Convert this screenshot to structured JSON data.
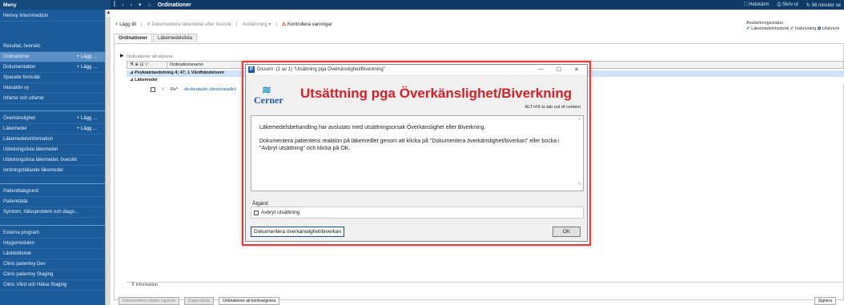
{
  "sidebar": {
    "title": "Meny",
    "header_item": "Hemvy Internmedicin",
    "items": [
      {
        "label": "Resultat, översikt",
        "add": ""
      },
      {
        "label": "Ordinationer",
        "add": "+ Lägg ..."
      },
      {
        "label": "Dokumentation",
        "add": "+ Lägg ..."
      },
      {
        "label": "Sparade formulär",
        "add": ""
      },
      {
        "label": "Interaktiv vy",
        "add": ""
      },
      {
        "label": "Infarter och utfarter",
        "add": ""
      },
      {
        "label": "Överkänslighet",
        "add": "+ Lägg ..."
      },
      {
        "label": "Läkemedel",
        "add": "+ Lägg ..."
      },
      {
        "label": "Läkemedelsinformation",
        "add": ""
      },
      {
        "label": "Utdelningslista läkemedel",
        "add": ""
      },
      {
        "label": "Utdelningslista läkemedel, översikt",
        "add": ""
      },
      {
        "label": "Iordningställande läkemedel",
        "add": ""
      },
      {
        "label": "Patientbakgrund",
        "add": ""
      },
      {
        "label": "Patientdata",
        "add": ""
      },
      {
        "label": "Symtom, hälsoproblem och diagn...",
        "add": ""
      },
      {
        "label": "Externa program",
        "add": ""
      },
      {
        "label": "Intygsmodulen",
        "add": ""
      },
      {
        "label": "Länkbibliotek",
        "add": ""
      },
      {
        "label": "Clinic patientvy Dev",
        "add": ""
      },
      {
        "label": "Clinic patientvy Staging",
        "add": ""
      },
      {
        "label": "Clinic Vård och Hälsa Staging",
        "add": ""
      }
    ]
  },
  "topbar": {
    "title": "Ordinationer",
    "fullscreen": "Helskärm",
    "print": "Skriv ut",
    "timer": "56 minuter se"
  },
  "toolbar": {
    "add": "Lägg till",
    "doc_history": "Dokumentera läkemedel efter historik",
    "reconcile": "Avstämning",
    "check_warnings": "Kontrollera varningar"
  },
  "avstamning": {
    "label": "Avstämningsstatus",
    "items": [
      "Läkemedelshistorik",
      "Inskrivning",
      "Utskrivni"
    ]
  },
  "tabs": [
    "Ordinationer",
    "Läkemedelslista"
  ],
  "orders": {
    "filter_text": "Ordinationer att signera",
    "col_name": "Ordinationsnamn",
    "group1": "Psykiatriavdelning 4; 47; 1 Vårdhändelsenr",
    "group2": "Läkemedel",
    "drug": "desloratadin (desloratadin)",
    "marker": "Rx*"
  },
  "info_label": "Information",
  "bottom_buttons": {
    "b1": "Dokumentera vården signerat",
    "b2": "Diagnoslista",
    "b3": "Ordinationer att kontrasignera",
    "sign": "Signera"
  },
  "dialog": {
    "title": "Discern: (1 av 1) \"Utsättning pga Överkänslighet/Biverkning\"",
    "logo_word": "Cerner",
    "heading": "Utsättning pga Överkänslighet/Biverkning",
    "shortcut": "ALT+F6 to tab out of content",
    "message1": "Läkemedelsbehandling har avslutats med utsättningsorsak Överkänslighet eller Biverkning.",
    "message2": "Dokumentera patientens reaktion på läkemedlet genom att klicka på \"Dokumentera överkänslighet/biverkan\" eller bocka i \"Avbryt utsättning\" och klicka på OK.",
    "action_label": "Åtgärd:",
    "checkbox_label": "Avbryt utsättning",
    "doc_button": "Dokumentera överkänslighet/biverkan",
    "ok_button": "OK"
  },
  "colors": {
    "sidebar": "#1b5b9a",
    "topbar": "#0f3a66",
    "heading_red": "#d91f26",
    "highlight_red": "#e53b3b"
  }
}
